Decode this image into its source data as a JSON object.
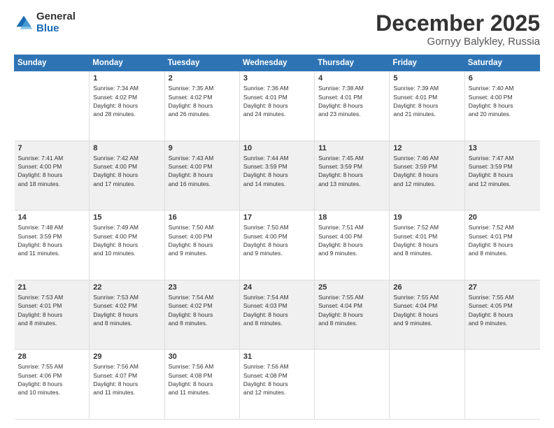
{
  "logo": {
    "general": "General",
    "blue": "Blue"
  },
  "title": "December 2025",
  "subtitle": "Gornyy Balykley, Russia",
  "header_days": [
    "Sunday",
    "Monday",
    "Tuesday",
    "Wednesday",
    "Thursday",
    "Friday",
    "Saturday"
  ],
  "weeks": [
    [
      {
        "num": "",
        "info": ""
      },
      {
        "num": "1",
        "info": "Sunrise: 7:34 AM\nSunset: 4:02 PM\nDaylight: 8 hours\nand 28 minutes."
      },
      {
        "num": "2",
        "info": "Sunrise: 7:35 AM\nSunset: 4:02 PM\nDaylight: 8 hours\nand 26 minutes."
      },
      {
        "num": "3",
        "info": "Sunrise: 7:36 AM\nSunset: 4:01 PM\nDaylight: 8 hours\nand 24 minutes."
      },
      {
        "num": "4",
        "info": "Sunrise: 7:38 AM\nSunset: 4:01 PM\nDaylight: 8 hours\nand 23 minutes."
      },
      {
        "num": "5",
        "info": "Sunrise: 7:39 AM\nSunset: 4:01 PM\nDaylight: 8 hours\nand 21 minutes."
      },
      {
        "num": "6",
        "info": "Sunrise: 7:40 AM\nSunset: 4:00 PM\nDaylight: 8 hours\nand 20 minutes."
      }
    ],
    [
      {
        "num": "7",
        "info": "Sunrise: 7:41 AM\nSunset: 4:00 PM\nDaylight: 8 hours\nand 18 minutes."
      },
      {
        "num": "8",
        "info": "Sunrise: 7:42 AM\nSunset: 4:00 PM\nDaylight: 8 hours\nand 17 minutes."
      },
      {
        "num": "9",
        "info": "Sunrise: 7:43 AM\nSunset: 4:00 PM\nDaylight: 8 hours\nand 16 minutes."
      },
      {
        "num": "10",
        "info": "Sunrise: 7:44 AM\nSunset: 3:59 PM\nDaylight: 8 hours\nand 14 minutes."
      },
      {
        "num": "11",
        "info": "Sunrise: 7:45 AM\nSunset: 3:59 PM\nDaylight: 8 hours\nand 13 minutes."
      },
      {
        "num": "12",
        "info": "Sunrise: 7:46 AM\nSunset: 3:59 PM\nDaylight: 8 hours\nand 12 minutes."
      },
      {
        "num": "13",
        "info": "Sunrise: 7:47 AM\nSunset: 3:59 PM\nDaylight: 8 hours\nand 12 minutes."
      }
    ],
    [
      {
        "num": "14",
        "info": "Sunrise: 7:48 AM\nSunset: 3:59 PM\nDaylight: 8 hours\nand 11 minutes."
      },
      {
        "num": "15",
        "info": "Sunrise: 7:49 AM\nSunset: 4:00 PM\nDaylight: 8 hours\nand 10 minutes."
      },
      {
        "num": "16",
        "info": "Sunrise: 7:50 AM\nSunset: 4:00 PM\nDaylight: 8 hours\nand 9 minutes."
      },
      {
        "num": "17",
        "info": "Sunrise: 7:50 AM\nSunset: 4:00 PM\nDaylight: 8 hours\nand 9 minutes."
      },
      {
        "num": "18",
        "info": "Sunrise: 7:51 AM\nSunset: 4:00 PM\nDaylight: 8 hours\nand 9 minutes."
      },
      {
        "num": "19",
        "info": "Sunrise: 7:52 AM\nSunset: 4:01 PM\nDaylight: 8 hours\nand 8 minutes."
      },
      {
        "num": "20",
        "info": "Sunrise: 7:52 AM\nSunset: 4:01 PM\nDaylight: 8 hours\nand 8 minutes."
      }
    ],
    [
      {
        "num": "21",
        "info": "Sunrise: 7:53 AM\nSunset: 4:01 PM\nDaylight: 8 hours\nand 8 minutes."
      },
      {
        "num": "22",
        "info": "Sunrise: 7:53 AM\nSunset: 4:02 PM\nDaylight: 8 hours\nand 8 minutes."
      },
      {
        "num": "23",
        "info": "Sunrise: 7:54 AM\nSunset: 4:02 PM\nDaylight: 8 hours\nand 8 minutes."
      },
      {
        "num": "24",
        "info": "Sunrise: 7:54 AM\nSunset: 4:03 PM\nDaylight: 8 hours\nand 8 minutes."
      },
      {
        "num": "25",
        "info": "Sunrise: 7:55 AM\nSunset: 4:04 PM\nDaylight: 8 hours\nand 8 minutes."
      },
      {
        "num": "26",
        "info": "Sunrise: 7:55 AM\nSunset: 4:04 PM\nDaylight: 8 hours\nand 9 minutes."
      },
      {
        "num": "27",
        "info": "Sunrise: 7:55 AM\nSunset: 4:05 PM\nDaylight: 8 hours\nand 9 minutes."
      }
    ],
    [
      {
        "num": "28",
        "info": "Sunrise: 7:55 AM\nSunset: 4:06 PM\nDaylight: 8 hours\nand 10 minutes."
      },
      {
        "num": "29",
        "info": "Sunrise: 7:56 AM\nSunset: 4:07 PM\nDaylight: 8 hours\nand 11 minutes."
      },
      {
        "num": "30",
        "info": "Sunrise: 7:56 AM\nSunset: 4:08 PM\nDaylight: 8 hours\nand 11 minutes."
      },
      {
        "num": "31",
        "info": "Sunrise: 7:56 AM\nSunset: 4:08 PM\nDaylight: 8 hours\nand 12 minutes."
      },
      {
        "num": "",
        "info": ""
      },
      {
        "num": "",
        "info": ""
      },
      {
        "num": "",
        "info": ""
      }
    ]
  ]
}
